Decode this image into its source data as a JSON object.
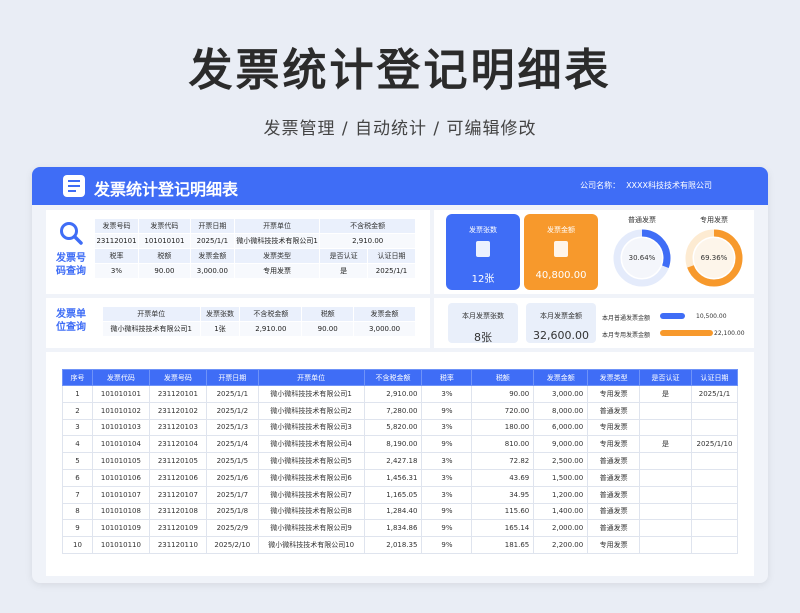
{
  "page": {
    "title": "发票统计登记明细表",
    "subtitle": "发票管理 / 自动统计 / 可编辑修改"
  },
  "header": {
    "title": "发票统计登记明细表",
    "company_label": "公司名称：",
    "company_name": "XXXX科技技术有限公司"
  },
  "query_invoice": {
    "label_line1": "发票号",
    "label_line2": "码查询",
    "headers1": [
      "发票号码",
      "发票代码",
      "开票日期",
      "开票单位",
      "不含税金额"
    ],
    "values1": [
      "231120101",
      "101010101",
      "2025/1/1",
      "微小微科技技术有限公司1",
      "2,910.00"
    ],
    "headers2": [
      "税率",
      "税额",
      "发票金额",
      "发票类型",
      "是否认证",
      "认证日期"
    ],
    "values2": [
      "3%",
      "90.00",
      "3,000.00",
      "专用发票",
      "是",
      "2025/1/1"
    ]
  },
  "query_unit": {
    "label_line1": "发票单",
    "label_line2": "位查询",
    "headers": [
      "开票单位",
      "发票张数",
      "不含税金额",
      "税额",
      "发票金额"
    ],
    "values": [
      "微小微科技技术有限公司1",
      "1张",
      "2,910.00",
      "90.00",
      "3,000.00"
    ]
  },
  "stats": {
    "count_label": "发票张数",
    "count_value": "12张",
    "amount_label": "发票金额",
    "amount_value": "40,800.00",
    "colors": {
      "blue": "#3f6df6",
      "orange": "#f7992c"
    }
  },
  "donuts": {
    "ordinary": {
      "label": "普通发票",
      "value": "30.64%",
      "fraction": 0.3064
    },
    "special": {
      "label": "专用发票",
      "value": "69.36%",
      "fraction": 0.6936
    }
  },
  "month": {
    "count_label": "本月发票张数",
    "count_value": "8张",
    "amount_label": "本月发票金额",
    "amount_value": "32,600.00",
    "bars": [
      {
        "label": "本月普通发票金额",
        "value": "10,500.00",
        "fraction": 0.32,
        "color": "#3f6df6"
      },
      {
        "label": "本月专用发票金额",
        "value": "22,100.00",
        "fraction": 0.68,
        "color": "#f7992c"
      }
    ]
  },
  "table": {
    "headers": [
      "序号",
      "发票代码",
      "发票号码",
      "开票日期",
      "开票单位",
      "不含税金额",
      "税率",
      "税额",
      "发票金额",
      "发票类型",
      "是否认证",
      "认证日期"
    ],
    "rows": [
      [
        "1",
        "101010101",
        "231120101",
        "2025/1/1",
        "微小微科技技术有限公司1",
        "2,910.00",
        "3%",
        "90.00",
        "3,000.00",
        "专用发票",
        "是",
        "2025/1/1"
      ],
      [
        "2",
        "101010102",
        "231120102",
        "2025/1/2",
        "微小微科技技术有限公司2",
        "7,280.00",
        "9%",
        "720.00",
        "8,000.00",
        "普通发票",
        "",
        ""
      ],
      [
        "3",
        "101010103",
        "231120103",
        "2025/1/3",
        "微小微科技技术有限公司3",
        "5,820.00",
        "3%",
        "180.00",
        "6,000.00",
        "专用发票",
        "",
        ""
      ],
      [
        "4",
        "101010104",
        "231120104",
        "2025/1/4",
        "微小微科技技术有限公司4",
        "8,190.00",
        "9%",
        "810.00",
        "9,000.00",
        "专用发票",
        "是",
        "2025/1/10"
      ],
      [
        "5",
        "101010105",
        "231120105",
        "2025/1/5",
        "微小微科技技术有限公司5",
        "2,427.18",
        "3%",
        "72.82",
        "2,500.00",
        "普通发票",
        "",
        ""
      ],
      [
        "6",
        "101010106",
        "231120106",
        "2025/1/6",
        "微小微科技技术有限公司6",
        "1,456.31",
        "3%",
        "43.69",
        "1,500.00",
        "普通发票",
        "",
        ""
      ],
      [
        "7",
        "101010107",
        "231120107",
        "2025/1/7",
        "微小微科技技术有限公司7",
        "1,165.05",
        "3%",
        "34.95",
        "1,200.00",
        "普通发票",
        "",
        ""
      ],
      [
        "8",
        "101010108",
        "231120108",
        "2025/1/8",
        "微小微科技技术有限公司8",
        "1,284.40",
        "9%",
        "115.60",
        "1,400.00",
        "普通发票",
        "",
        ""
      ],
      [
        "9",
        "101010109",
        "231120109",
        "2025/2/9",
        "微小微科技技术有限公司9",
        "1,834.86",
        "9%",
        "165.14",
        "2,000.00",
        "普通发票",
        "",
        ""
      ],
      [
        "10",
        "101010110",
        "231120110",
        "2025/2/10",
        "微小微科技技术有限公司10",
        "2,018.35",
        "9%",
        "181.65",
        "2,200.00",
        "专用发票",
        "",
        ""
      ]
    ]
  }
}
